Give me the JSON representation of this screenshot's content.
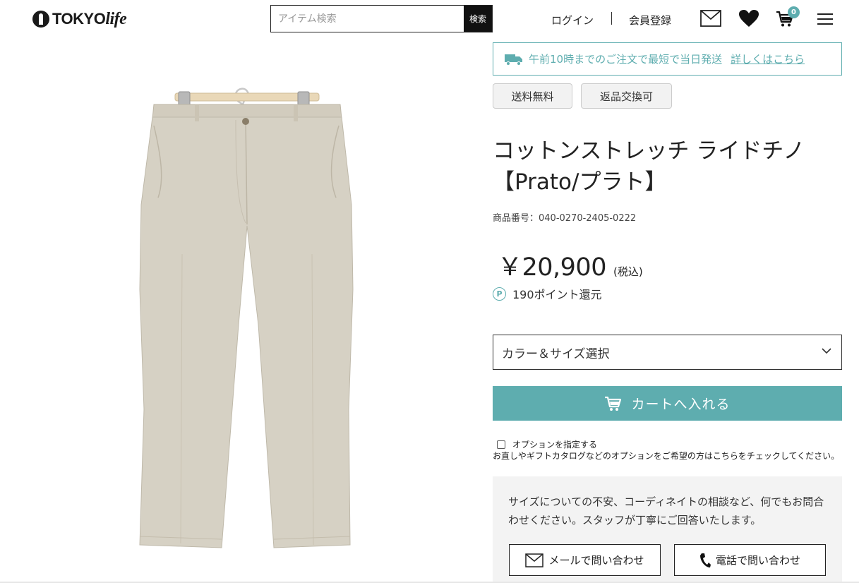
{
  "header": {
    "logo_text_main": "TOKYO",
    "logo_text_sub": "life",
    "search_placeholder": "アイテム検索",
    "search_button": "検索",
    "login": "ログイン",
    "register": "会員登録",
    "cart_count": "0",
    "icons": [
      "mail-icon",
      "heart-icon",
      "cart-icon",
      "menu-icon"
    ]
  },
  "shipping": {
    "text": "午前10時までのご注文で最短で当日発送",
    "link": "詳しくはこちら"
  },
  "tags": [
    "送料無料",
    "返品交換可"
  ],
  "product": {
    "title_line1": "コットンストレッチ ライドチノ",
    "title_line2": "【Prato/プラト】",
    "code": "商品番号：040-0270-2405-0222",
    "price": "￥20,900",
    "tax": "(税込)",
    "points_icon": "P",
    "points": "190ポイント還元",
    "image_color": "#d6d1c4"
  },
  "select": {
    "label": "カラー＆サイズ選択"
  },
  "cart_button": "カートへ入れる",
  "option": {
    "checkbox_label": "オプションを指定する",
    "note": "お直しやギフトカタログなどのオプションをご希望の方はこちらをチェックしてください。"
  },
  "contact": {
    "text": "サイズについての不安、コーディネイトの相談など、何でもお問合わせください。スタッフが丁寧にご回答いたします。",
    "mail_button": "メールで問い合わせ",
    "phone_button": "電話で問い合わせ"
  },
  "colors": {
    "accent": "#5eadaf",
    "text": "#333333",
    "contact_bg": "#f3f3f3"
  }
}
